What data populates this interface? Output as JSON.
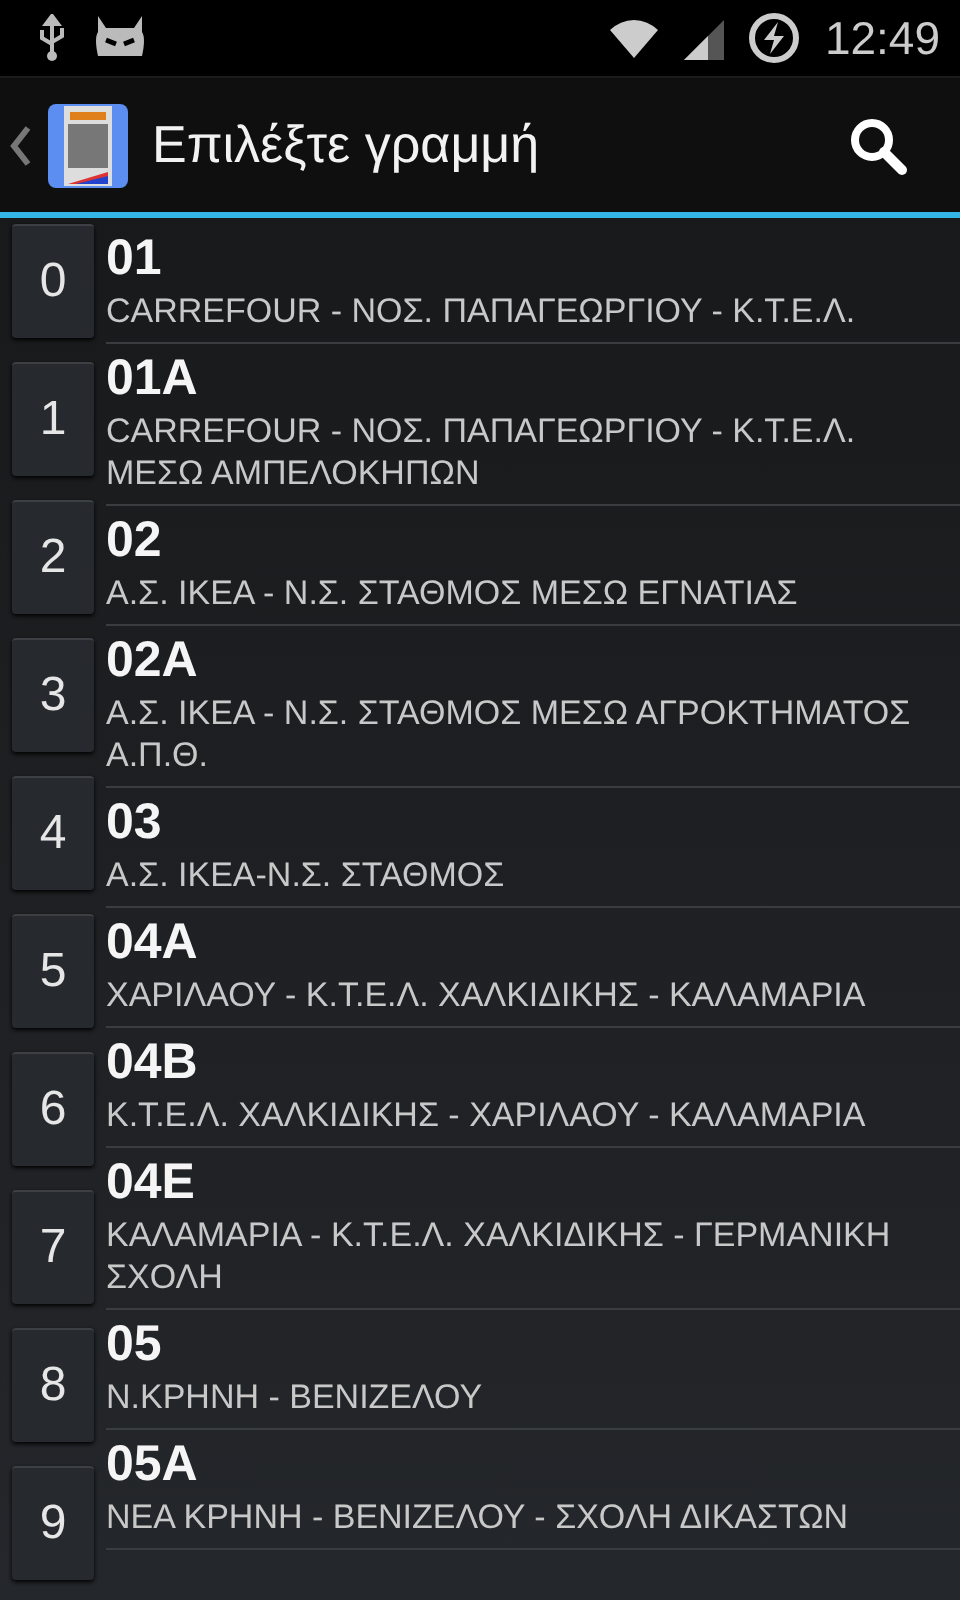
{
  "status_bar": {
    "time": "12:49"
  },
  "action_bar": {
    "title": "Επιλέξτε γραμμή"
  },
  "index": [
    "0",
    "1",
    "2",
    "3",
    "4",
    "5",
    "6",
    "7",
    "8",
    "9"
  ],
  "lines": [
    {
      "number": "01",
      "route": "CARREFOUR - ΝΟΣ. ΠΑΠΑΓΕΩΡΓΙΟΥ - Κ.Τ.Ε.Λ."
    },
    {
      "number": "01A",
      "route": "CARREFOUR - ΝΟΣ. ΠΑΠΑΓΕΩΡΓΙΟΥ - Κ.Τ.Ε.Λ. ΜΕΣΩ ΑΜΠΕΛΟΚΗΠΩΝ"
    },
    {
      "number": "02",
      "route": "Α.Σ. ΙΚΕΑ - Ν.Σ. ΣΤΑΘΜΟΣ ΜΕΣΩ ΕΓΝΑΤΙΑΣ"
    },
    {
      "number": "02A",
      "route": "Α.Σ. ΙΚΕΑ - Ν.Σ. ΣΤΑΘΜΟΣ ΜΕΣΩ ΑΓΡΟΚΤΗΜΑΤΟΣ Α.Π.Θ."
    },
    {
      "number": "03",
      "route": "Α.Σ. ΙΚΕΑ-Ν.Σ. ΣΤΑΘΜΟΣ"
    },
    {
      "number": "04A",
      "route": "ΧΑΡΙΛΑΟΥ - Κ.Τ.Ε.Λ. ΧΑΛΚΙΔΙΚΗΣ - ΚΑΛΑΜΑΡΙΑ"
    },
    {
      "number": "04B",
      "route": "Κ.Τ.Ε.Λ. ΧΑΛΚΙΔΙΚΗΣ - ΧΑΡΙΛΑΟΥ - ΚΑΛΑΜΑΡΙΑ"
    },
    {
      "number": "04E",
      "route": "ΚΑΛΑΜΑΡΙΑ - Κ.Τ.Ε.Λ. ΧΑΛΚΙΔΙΚΗΣ - ΓΕΡΜΑΝΙΚΗ ΣΧΟΛΗ"
    },
    {
      "number": "05",
      "route": "Ν.ΚΡΗΝΗ - ΒΕΝΙΖΕΛΟΥ"
    },
    {
      "number": "05A",
      "route": "ΝΕΑ ΚΡΗΝΗ - ΒΕΝΙΖΕΛΟΥ - ΣΧΟΛΗ ΔΙΚΑΣΤΩΝ"
    }
  ]
}
